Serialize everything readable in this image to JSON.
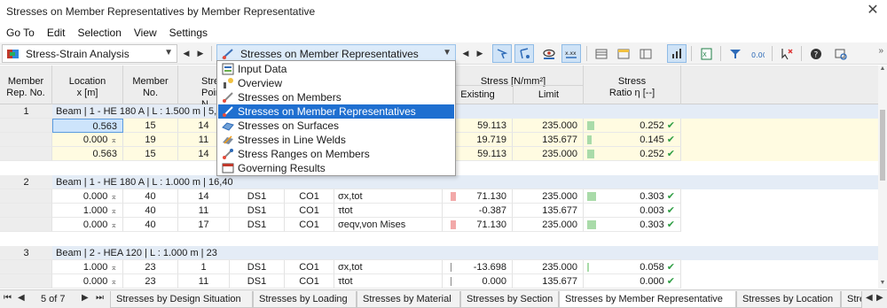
{
  "window": {
    "title": "Stresses on Member Representatives by Member Representative"
  },
  "menu": [
    "Go To",
    "Edit",
    "Selection",
    "View",
    "Settings"
  ],
  "toolbar": {
    "analysis_combo": "Stress-Strain Analysis",
    "result_combo": "Stresses on Member Representatives"
  },
  "dropdown": {
    "items": [
      "Input Data",
      "Overview",
      "Stresses on Members",
      "Stresses on Member Representatives",
      "Stresses on Surfaces",
      "Stresses in Line Welds",
      "Stress Ranges on Members",
      "Governing Results"
    ],
    "selected_index": 3
  },
  "table": {
    "headers": {
      "member_rep_no": [
        "Member",
        "Rep. No."
      ],
      "location": [
        "Location",
        "x [m]"
      ],
      "member_no": [
        "Member",
        "No."
      ],
      "stress_point": [
        "Stress",
        "Point N"
      ],
      "stress_group": "Stress [N/mm²]",
      "existing": "Existing",
      "limit": "Limit",
      "ratio": [
        "Stress",
        "Ratio η [--]"
      ]
    },
    "groups": [
      {
        "rep_no": "1",
        "label": "Beam | 1 - HE 180 A | L : 1.500 m | 5,9",
        "rows": [
          {
            "x": "0.563",
            "member": "15",
            "point": "14",
            "ds": "",
            "co": "",
            "type": "",
            "existing": "59.113",
            "limit": "235.000",
            "ratio": "0.252",
            "ratio_frac": 0.252
          },
          {
            "x": "0.000",
            "member": "19",
            "point": "11",
            "ds": "",
            "co": "",
            "type": "",
            "existing": "19.719",
            "limit": "135.677",
            "ratio": "0.145",
            "ratio_frac": 0.145
          },
          {
            "x": "0.563",
            "member": "15",
            "point": "14",
            "ds": "",
            "co": "",
            "type": "",
            "existing": "59.113",
            "limit": "235.000",
            "ratio": "0.252",
            "ratio_frac": 0.252
          }
        ]
      },
      {
        "rep_no": "2",
        "label": "Beam | 1 - HE 180 A | L : 1.000 m | 16,40",
        "rows": [
          {
            "x": "0.000",
            "member": "40",
            "point": "14",
            "ds": "DS1",
            "co": "CO1",
            "type": "σx,tot",
            "existing": "71.130",
            "limit": "235.000",
            "ratio": "0.303",
            "ratio_frac": 0.303
          },
          {
            "x": "1.000",
            "member": "40",
            "point": "11",
            "ds": "DS1",
            "co": "CO1",
            "type": "τtot",
            "existing": "-0.387",
            "limit": "135.677",
            "ratio": "0.003",
            "ratio_frac": 0.003
          },
          {
            "x": "0.000",
            "member": "40",
            "point": "17",
            "ds": "DS1",
            "co": "CO1",
            "type": "σeqv,von Mises",
            "existing": "71.130",
            "limit": "235.000",
            "ratio": "0.303",
            "ratio_frac": 0.303
          }
        ]
      },
      {
        "rep_no": "3",
        "label": "Beam | 2 - HEA 120 | L : 1.000 m | 23",
        "rows": [
          {
            "x": "1.000",
            "member": "23",
            "point": "1",
            "ds": "DS1",
            "co": "CO1",
            "type": "σx,tot",
            "existing": "-13.698",
            "limit": "235.000",
            "ratio": "0.058",
            "ratio_frac": 0.058
          },
          {
            "x": "0.000",
            "member": "23",
            "point": "11",
            "ds": "DS1",
            "co": "CO1",
            "type": "τtot",
            "existing": "0.000",
            "limit": "135.677",
            "ratio": "0.000",
            "ratio_frac": 0.0
          }
        ]
      }
    ]
  },
  "pager": {
    "text": "5 of 7"
  },
  "tabs": [
    "Stresses by Design Situation",
    "Stresses by Loading",
    "Stresses by Material",
    "Stresses by Section",
    "Stresses by Member Representative",
    "Stresses by Location",
    "Stre"
  ],
  "active_tab_index": 4
}
